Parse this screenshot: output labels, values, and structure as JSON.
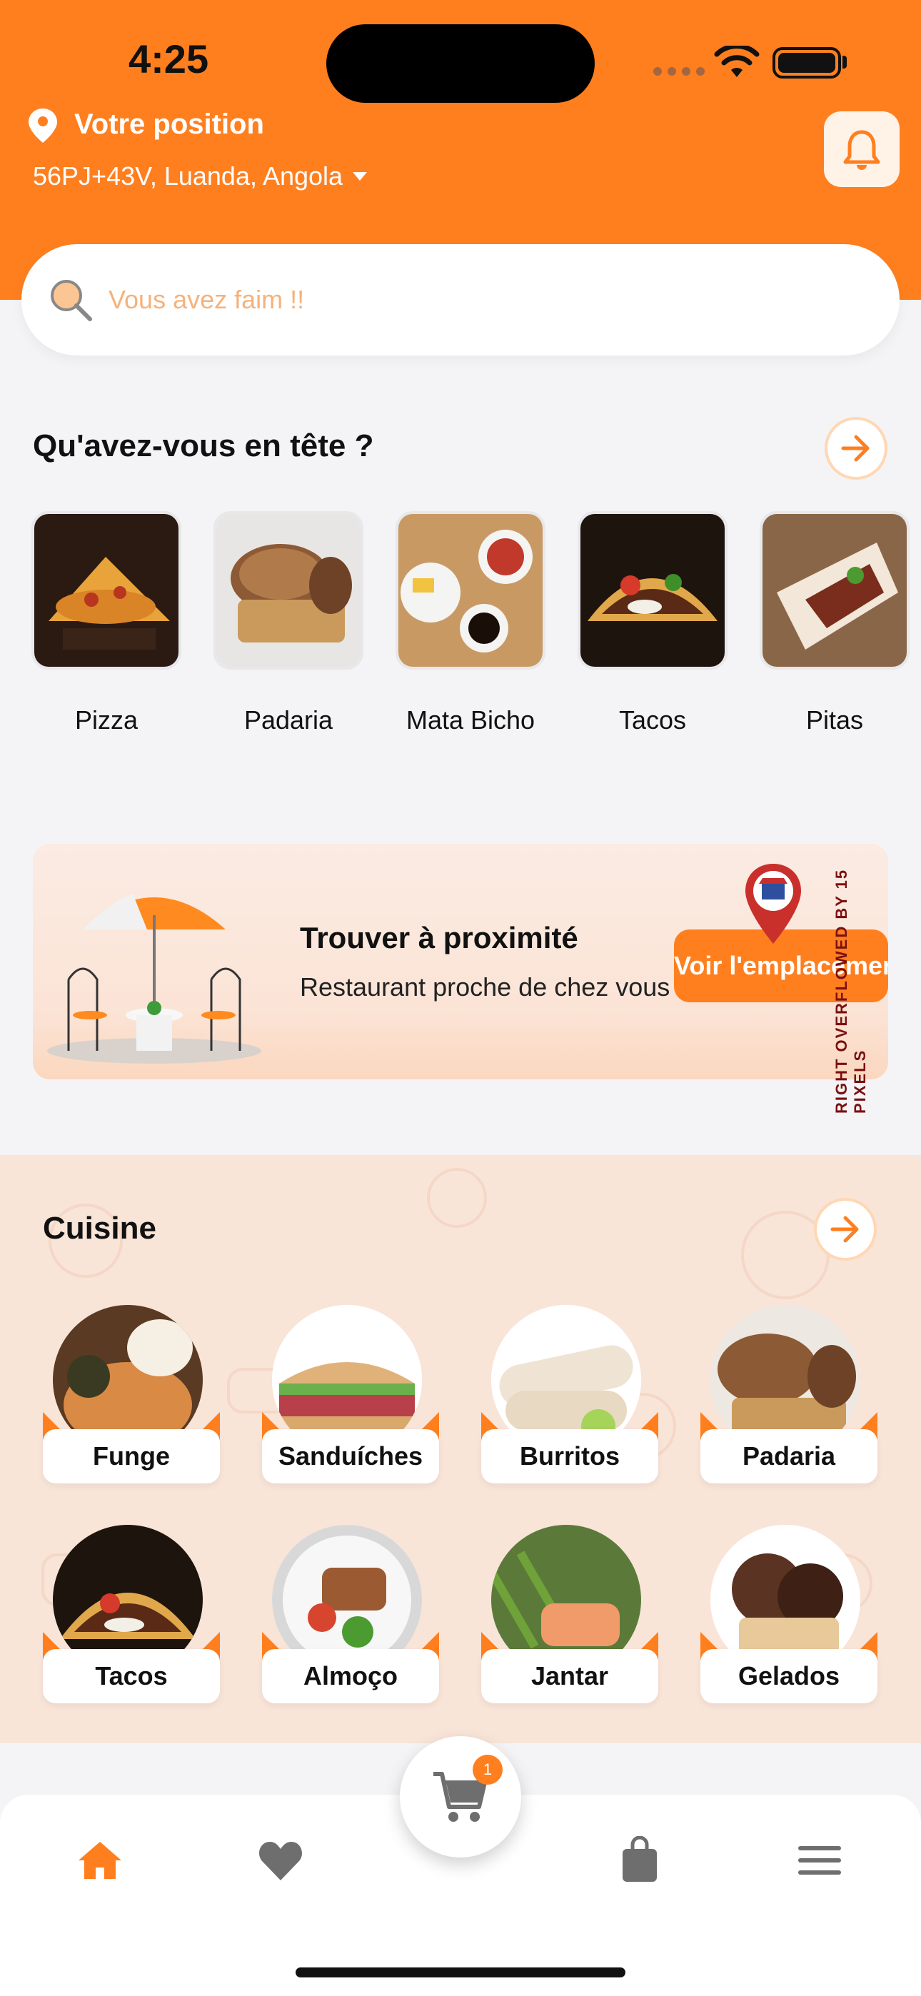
{
  "status": {
    "time": "4:25"
  },
  "header": {
    "position_label": "Votre position",
    "address": "56PJ+43V, Luanda, Angola"
  },
  "search": {
    "placeholder": "Vous avez faim !!"
  },
  "categories": {
    "title": "Qu'avez-vous en tête ?",
    "items": [
      {
        "label": "Pizza"
      },
      {
        "label": "Padaria"
      },
      {
        "label": "Mata Bicho"
      },
      {
        "label": "Tacos"
      },
      {
        "label": "Pitas"
      }
    ]
  },
  "promo": {
    "title": "Trouver à proximité",
    "subtitle": "Restaurant proche de chez vous",
    "button_label": "Voir l'emplacement",
    "overflow_warning": "RIGHT OVERFLOWED BY 15 PIXELS"
  },
  "cuisine": {
    "title": "Cuisine",
    "items": [
      {
        "label": "Funge"
      },
      {
        "label": "Sanduíches"
      },
      {
        "label": "Burritos"
      },
      {
        "label": "Padaria"
      },
      {
        "label": "Tacos"
      },
      {
        "label": "Almoço"
      },
      {
        "label": "Jantar"
      },
      {
        "label": "Gelados"
      }
    ]
  },
  "cart": {
    "count": "1"
  },
  "nav": {
    "icons": [
      "home-icon",
      "heart-icon",
      "cart-icon",
      "bag-icon",
      "menu-icon"
    ]
  },
  "colors": {
    "accent": "#ff7f1f",
    "background": "#f4f4f6",
    "cuisine_bg": "#f9e4d8"
  }
}
